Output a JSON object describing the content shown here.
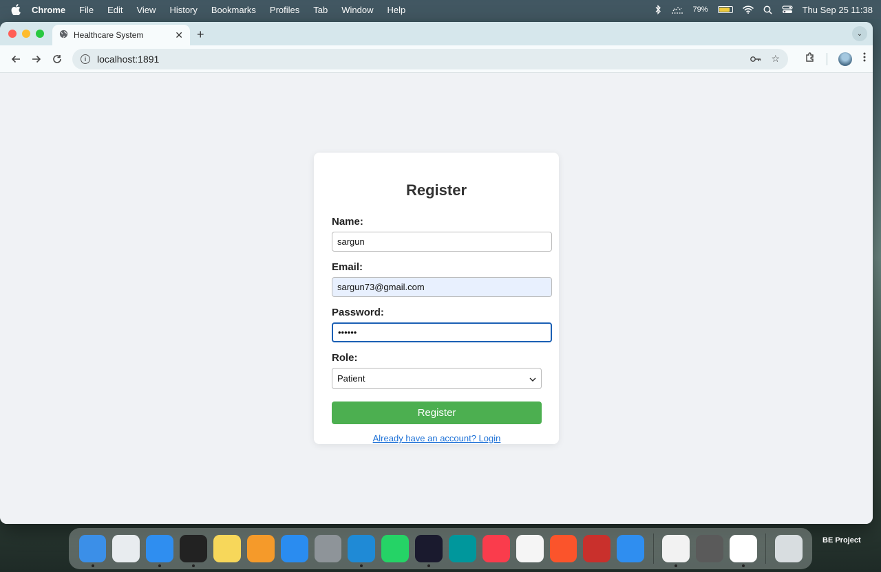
{
  "menubar": {
    "app": "Chrome",
    "items": [
      "File",
      "Edit",
      "View",
      "History",
      "Bookmarks",
      "Profiles",
      "Tab",
      "Window",
      "Help"
    ],
    "battery": "79%",
    "datetime": "Thu Sep 25  11:38"
  },
  "browser": {
    "tab_title": "Healthcare System",
    "url": "localhost:1891"
  },
  "form": {
    "title": "Register",
    "name_label": "Name:",
    "name_value": "sargun",
    "email_label": "Email:",
    "email_value": "sargun73@gmail.com",
    "password_label": "Password:",
    "password_value": "••••••",
    "role_label": "Role:",
    "role_value": "Patient",
    "submit_label": "Register",
    "login_link": "Already have an account? Login"
  },
  "dock": {
    "apps": [
      {
        "name": "finder-icon",
        "color": "#3b8fe8"
      },
      {
        "name": "launchpad-icon",
        "color": "#e8ecef"
      },
      {
        "name": "safari-icon",
        "color": "#2f8ef0"
      },
      {
        "name": "terminal-icon",
        "color": "#222222"
      },
      {
        "name": "notes-icon",
        "color": "#f7d75a"
      },
      {
        "name": "pages-icon",
        "color": "#f59a2a"
      },
      {
        "name": "app-store-icon",
        "color": "#2a8cf0"
      },
      {
        "name": "system-settings-icon",
        "color": "#8e9499"
      },
      {
        "name": "vscode-icon",
        "color": "#1f8ad6"
      },
      {
        "name": "whatsapp-icon",
        "color": "#25d366"
      },
      {
        "name": "intellij-icon",
        "color": "#1a1a2e"
      },
      {
        "name": "arduino-icon",
        "color": "#00979c"
      },
      {
        "name": "music-icon",
        "color": "#fa3c4c"
      },
      {
        "name": "photos-icon",
        "color": "#f5f5f5"
      },
      {
        "name": "brave-icon",
        "color": "#fb542b"
      },
      {
        "name": "flashcards-icon",
        "color": "#c9302c"
      },
      {
        "name": "keynote-icon",
        "color": "#2f8ef0"
      },
      {
        "name": "chrome-icon",
        "color": "#f2f2f2"
      },
      {
        "name": "calculator-icon",
        "color": "#5a5a5a"
      },
      {
        "name": "mongodb-compass-icon",
        "color": "#ffffff"
      },
      {
        "name": "trash-icon",
        "color": "#d8dde0"
      }
    ],
    "label": "BE Project"
  }
}
